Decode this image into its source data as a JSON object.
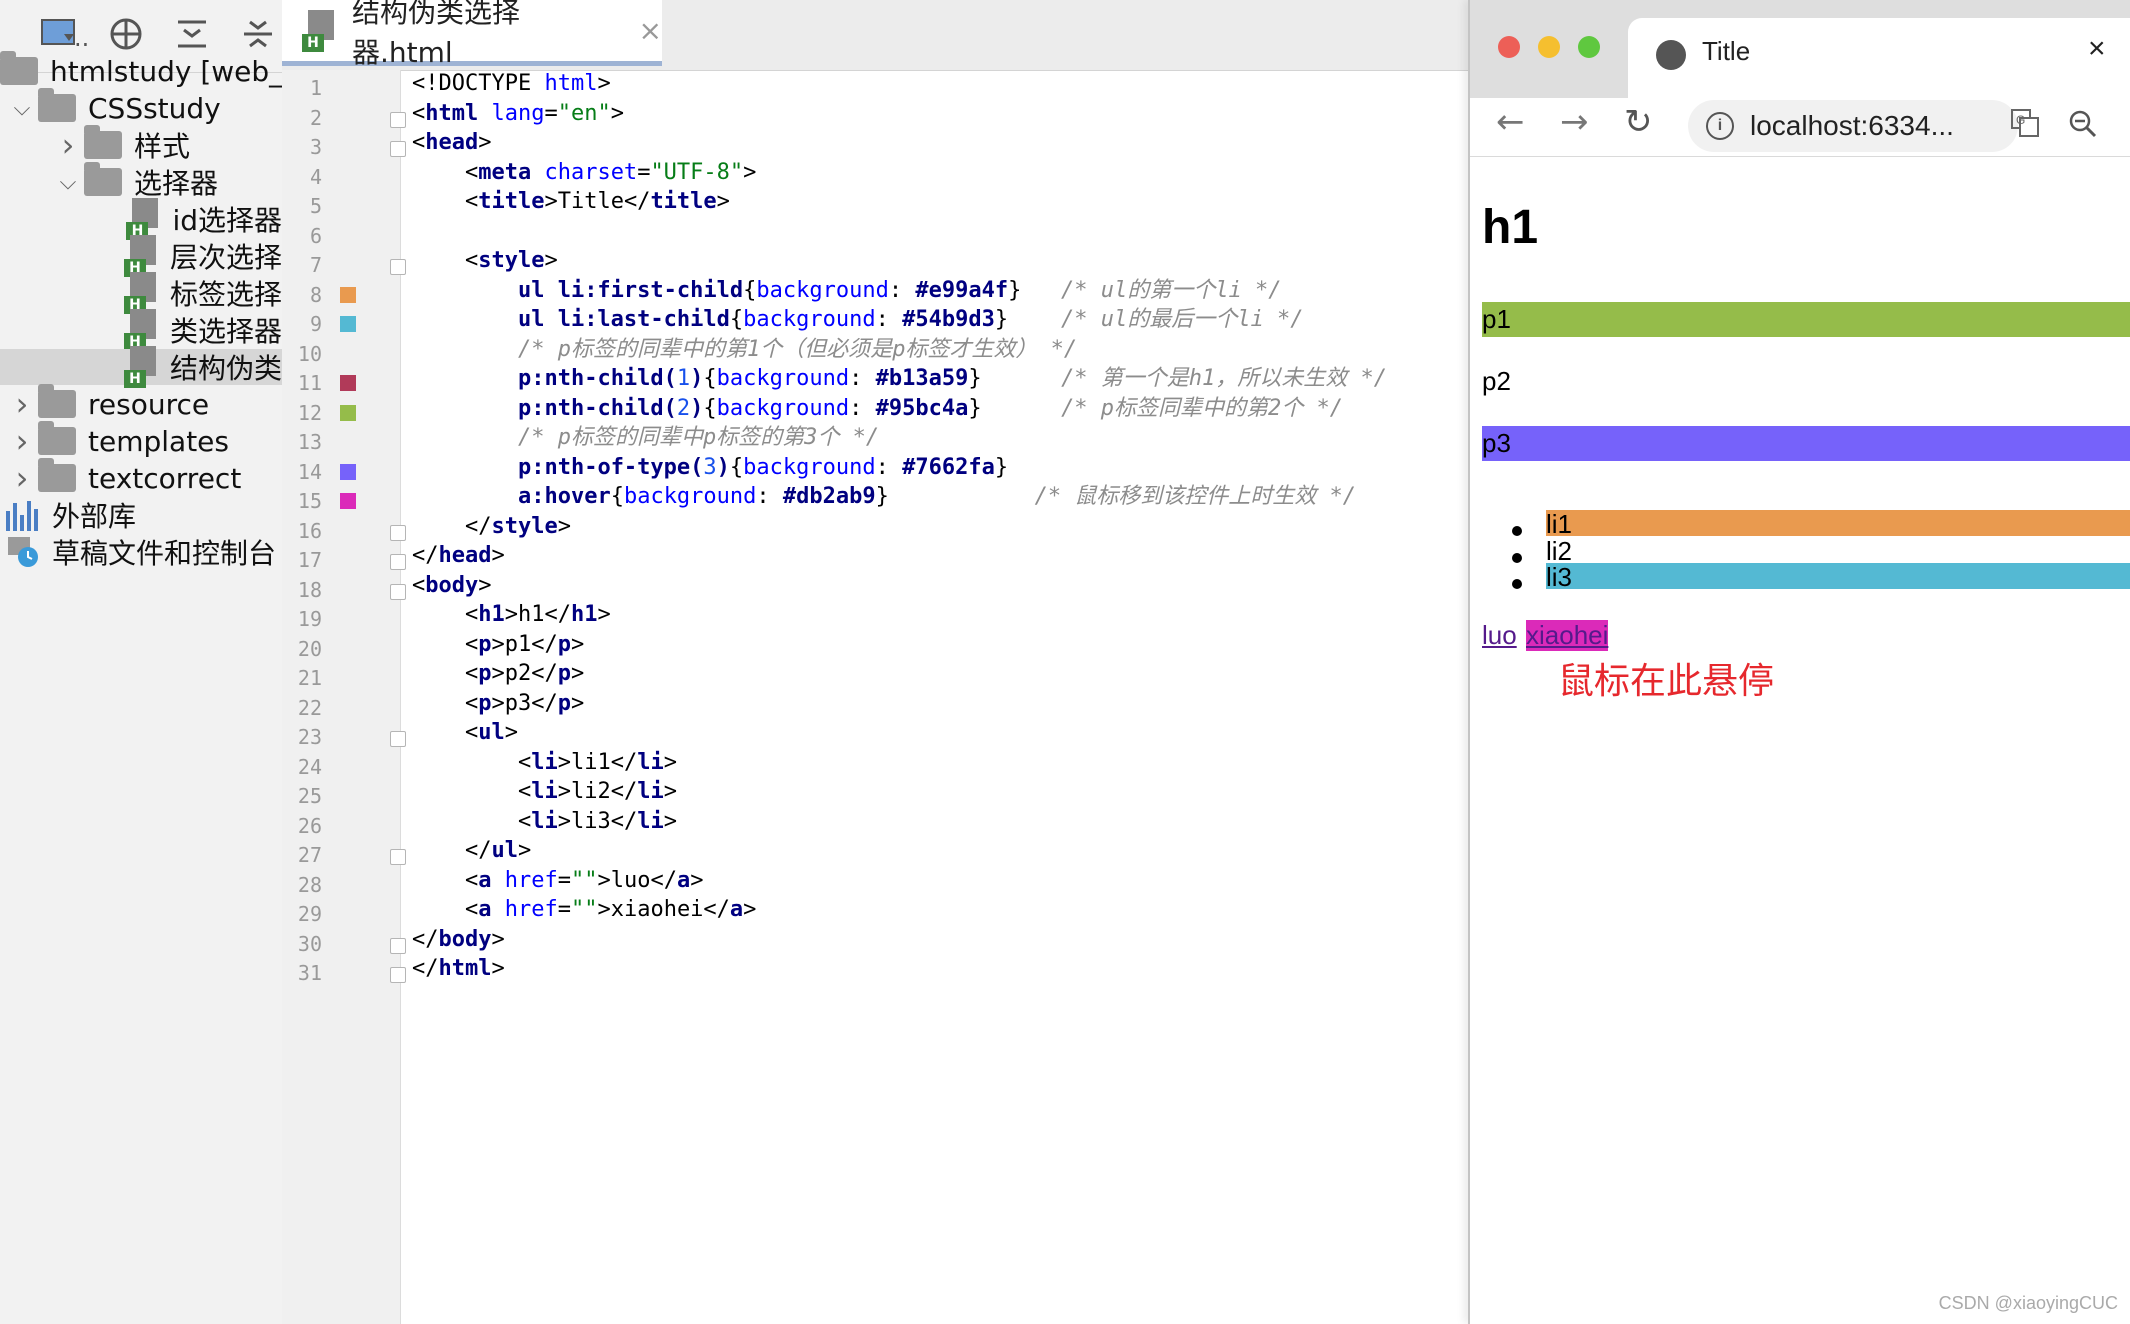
{
  "project": {
    "toolbar": {
      "view_label": "..",
      "icons": [
        "project-view-icon",
        "target-icon",
        "collapse-icon",
        "expand-icon"
      ]
    },
    "tree": [
      {
        "label": "htmlstudy [web_",
        "type": "folder",
        "level": 0,
        "arrow": ""
      },
      {
        "label": "CSSstudy",
        "type": "folder",
        "level": 0,
        "arrow": "down"
      },
      {
        "label": "样式",
        "type": "folder",
        "level": 1,
        "arrow": "right"
      },
      {
        "label": "选择器",
        "type": "folder",
        "level": 1,
        "arrow": "down"
      },
      {
        "label": "id选择器",
        "type": "html",
        "level": 2,
        "arrow": ""
      },
      {
        "label": "层次选择",
        "type": "html",
        "level": 2,
        "arrow": ""
      },
      {
        "label": "标签选择",
        "type": "html",
        "level": 2,
        "arrow": ""
      },
      {
        "label": "类选择器",
        "type": "html",
        "level": 2,
        "arrow": ""
      },
      {
        "label": "结构伪类",
        "type": "html",
        "level": 2,
        "arrow": "",
        "selected": true
      },
      {
        "label": "resource",
        "type": "folder",
        "level": 0,
        "arrow": "right"
      },
      {
        "label": "templates",
        "type": "folder",
        "level": 0,
        "arrow": "right"
      },
      {
        "label": "textcorrect",
        "type": "folder",
        "level": 0,
        "arrow": "right"
      },
      {
        "label": "外部库",
        "type": "lib",
        "level": -1,
        "arrow": ""
      },
      {
        "label": "草稿文件和控制台",
        "type": "scratch",
        "level": -1,
        "arrow": ""
      }
    ]
  },
  "editor": {
    "tab": {
      "title": "结构伪类选择器.html",
      "close": "×",
      "badge": "H"
    },
    "swatches": {
      "8": "#e99a4f",
      "9": "#54b9d3",
      "11": "#b13a59",
      "12": "#95bc4a",
      "14": "#7662fa",
      "15": "#db2ab9"
    },
    "lines": [
      [
        [
          "<!DOCTYPE ",
          "t"
        ],
        [
          "html",
          "a"
        ],
        [
          ">",
          "t"
        ]
      ],
      [
        [
          "<",
          "t"
        ],
        [
          "html",
          "k"
        ],
        [
          " lang",
          "a"
        ],
        [
          "=",
          "t"
        ],
        [
          "\"en\"",
          "s"
        ],
        [
          ">",
          "t"
        ]
      ],
      [
        [
          "<",
          "t"
        ],
        [
          "head",
          "k"
        ],
        [
          ">",
          "t"
        ]
      ],
      [
        [
          "    <",
          "t"
        ],
        [
          "meta",
          "k"
        ],
        [
          " charset",
          "a"
        ],
        [
          "=",
          "t"
        ],
        [
          "\"UTF-8\"",
          "s"
        ],
        [
          ">",
          "t"
        ]
      ],
      [
        [
          "    <",
          "t"
        ],
        [
          "title",
          "k"
        ],
        [
          ">Title</",
          "t"
        ],
        [
          "title",
          "k"
        ],
        [
          ">",
          "t"
        ]
      ],
      [
        [
          "",
          "t"
        ]
      ],
      [
        [
          "    <",
          "t"
        ],
        [
          "style",
          "k"
        ],
        [
          ">",
          "t"
        ]
      ],
      [
        [
          "        ul li",
          "k"
        ],
        [
          ":first-child",
          "k"
        ],
        [
          "{",
          "t"
        ],
        [
          "background",
          "a"
        ],
        [
          ": ",
          "t"
        ],
        [
          "#e99a4f",
          "k"
        ],
        [
          "}",
          "t"
        ],
        [
          "   /* ul的第一个li */",
          "c"
        ]
      ],
      [
        [
          "        ul li",
          "k"
        ],
        [
          ":last-child",
          "k"
        ],
        [
          "{",
          "t"
        ],
        [
          "background",
          "a"
        ],
        [
          ": ",
          "t"
        ],
        [
          "#54b9d3",
          "k"
        ],
        [
          "}",
          "t"
        ],
        [
          "    /* ul的最后一个li */",
          "c"
        ]
      ],
      [
        [
          "        /* p标签的同辈中的第1个（但必须是p标签才生效） */",
          "c"
        ]
      ],
      [
        [
          "        p",
          "k"
        ],
        [
          ":nth-child(",
          "k"
        ],
        [
          "1",
          "n"
        ],
        [
          ")",
          "k"
        ],
        [
          "{",
          "t"
        ],
        [
          "background",
          "a"
        ],
        [
          ": ",
          "t"
        ],
        [
          "#b13a59",
          "k"
        ],
        [
          "}",
          "t"
        ],
        [
          "      /* 第一个是h1，所以未生效 */",
          "c"
        ]
      ],
      [
        [
          "        p",
          "k"
        ],
        [
          ":nth-child(",
          "k"
        ],
        [
          "2",
          "n"
        ],
        [
          ")",
          "k"
        ],
        [
          "{",
          "t"
        ],
        [
          "background",
          "a"
        ],
        [
          ": ",
          "t"
        ],
        [
          "#95bc4a",
          "k"
        ],
        [
          "}",
          "t"
        ],
        [
          "      /* p标签同辈中的第2个 */",
          "c"
        ]
      ],
      [
        [
          "        /* p标签的同辈中p标签的第3个 */",
          "c"
        ]
      ],
      [
        [
          "        p",
          "k"
        ],
        [
          ":nth-of-type(",
          "k"
        ],
        [
          "3",
          "n"
        ],
        [
          ")",
          "k"
        ],
        [
          "{",
          "t"
        ],
        [
          "background",
          "a"
        ],
        [
          ": ",
          "t"
        ],
        [
          "#7662fa",
          "k"
        ],
        [
          "}",
          "t"
        ]
      ],
      [
        [
          "        a",
          "k"
        ],
        [
          ":hover",
          "k"
        ],
        [
          "{",
          "t"
        ],
        [
          "background",
          "a"
        ],
        [
          ": ",
          "t"
        ],
        [
          "#db2ab9",
          "k"
        ],
        [
          "}",
          "t"
        ],
        [
          "           /* 鼠标移到该控件上时生效 */",
          "c"
        ]
      ],
      [
        [
          "    </",
          "t"
        ],
        [
          "style",
          "k"
        ],
        [
          ">",
          "t"
        ]
      ],
      [
        [
          "</",
          "t"
        ],
        [
          "head",
          "k"
        ],
        [
          ">",
          "t"
        ]
      ],
      [
        [
          "<",
          "t"
        ],
        [
          "body",
          "k"
        ],
        [
          ">",
          "t"
        ]
      ],
      [
        [
          "    <",
          "t"
        ],
        [
          "h1",
          "k"
        ],
        [
          ">h1</",
          "t"
        ],
        [
          "h1",
          "k"
        ],
        [
          ">",
          "t"
        ]
      ],
      [
        [
          "    <",
          "t"
        ],
        [
          "p",
          "k"
        ],
        [
          ">p1</",
          "t"
        ],
        [
          "p",
          "k"
        ],
        [
          ">",
          "t"
        ]
      ],
      [
        [
          "    <",
          "t"
        ],
        [
          "p",
          "k"
        ],
        [
          ">p2</",
          "t"
        ],
        [
          "p",
          "k"
        ],
        [
          ">",
          "t"
        ]
      ],
      [
        [
          "    <",
          "t"
        ],
        [
          "p",
          "k"
        ],
        [
          ">p3</",
          "t"
        ],
        [
          "p",
          "k"
        ],
        [
          ">",
          "t"
        ]
      ],
      [
        [
          "    <",
          "t"
        ],
        [
          "ul",
          "k"
        ],
        [
          ">",
          "t"
        ]
      ],
      [
        [
          "        <",
          "t"
        ],
        [
          "li",
          "k"
        ],
        [
          ">li1</",
          "t"
        ],
        [
          "li",
          "k"
        ],
        [
          ">",
          "t"
        ]
      ],
      [
        [
          "        <",
          "t"
        ],
        [
          "li",
          "k"
        ],
        [
          ">li2</",
          "t"
        ],
        [
          "li",
          "k"
        ],
        [
          ">",
          "t"
        ]
      ],
      [
        [
          "        <",
          "t"
        ],
        [
          "li",
          "k"
        ],
        [
          ">li3</",
          "t"
        ],
        [
          "li",
          "k"
        ],
        [
          ">",
          "t"
        ]
      ],
      [
        [
          "    </",
          "t"
        ],
        [
          "ul",
          "k"
        ],
        [
          ">",
          "t"
        ]
      ],
      [
        [
          "    <",
          "t"
        ],
        [
          "a",
          "k"
        ],
        [
          " href",
          "a"
        ],
        [
          "=",
          "t"
        ],
        [
          "\"\"",
          "s"
        ],
        [
          ">luo</",
          "t"
        ],
        [
          "a",
          "k"
        ],
        [
          ">",
          "t"
        ]
      ],
      [
        [
          "    <",
          "t"
        ],
        [
          "a",
          "k"
        ],
        [
          " href",
          "a"
        ],
        [
          "=",
          "t"
        ],
        [
          "\"\"",
          "s"
        ],
        [
          ">xiaohei</",
          "t"
        ],
        [
          "a",
          "k"
        ],
        [
          ">",
          "t"
        ]
      ],
      [
        [
          "</",
          "t"
        ],
        [
          "body",
          "k"
        ],
        [
          ">",
          "t"
        ]
      ],
      [
        [
          "</",
          "t"
        ],
        [
          "html",
          "k"
        ],
        [
          ">",
          "t"
        ]
      ]
    ],
    "token_colors": {
      "t": "#000000",
      "k": "#000080",
      "a": "#0000ff",
      "s": "#067d17",
      "c": "#8c8c8c",
      "n": "#1750eb"
    }
  },
  "browser": {
    "tab_title": "Title",
    "tab_close": "×",
    "url": "localhost:6334...",
    "page": {
      "h1": "h1",
      "p1": "p1",
      "p1_bg": "#95bc4a",
      "p2": "p2",
      "p3": "p3",
      "p3_bg": "#7662fa",
      "li": [
        {
          "text": "li1",
          "bg": "#e99a4f"
        },
        {
          "text": "li2",
          "bg": ""
        },
        {
          "text": "li3",
          "bg": "#54b9d3"
        }
      ],
      "link1": "luo",
      "link2": "xiaohei",
      "link2_bg": "#db2ab9",
      "annotation": "鼠标在此悬停"
    }
  },
  "watermark": "CSDN @xiaoyingCUC"
}
